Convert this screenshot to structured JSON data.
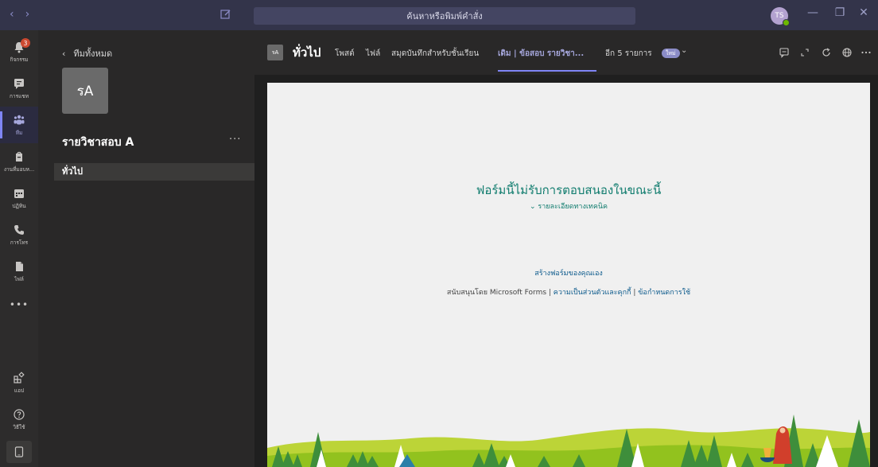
{
  "titlebar": {
    "search_placeholder": "ค้นหาหรือพิมพ์คำสั่ง",
    "avatar_initials": "TS",
    "back_arrow": "‹",
    "forward_arrow": "›",
    "minimize": "—",
    "maximize": "❐",
    "close": "✕"
  },
  "rail": {
    "items": [
      {
        "label": "กิจกรรม",
        "icon": "bell-icon",
        "badge": "3"
      },
      {
        "label": "การแชท",
        "icon": "chat-icon"
      },
      {
        "label": "ทีม",
        "icon": "teams-icon"
      },
      {
        "label": "งานที่มอบห...",
        "icon": "assignments-icon"
      },
      {
        "label": "ปฏิทิน",
        "icon": "calendar-icon"
      },
      {
        "label": "การโทร",
        "icon": "phone-icon"
      },
      {
        "label": "ไฟล์",
        "icon": "file-icon"
      },
      {
        "label": "แอป",
        "icon": "apps-icon"
      },
      {
        "label": "วิธีใช้",
        "icon": "help-icon"
      }
    ],
    "more": "•••",
    "active_accent": "#7f85f5"
  },
  "panel": {
    "back_label": "ทีมทั้งหมด",
    "back_icon": "‹",
    "team_initials": "รA",
    "team_name": "รายวิชาสอบ A",
    "team_more": "···",
    "channel": "ทั่วไป"
  },
  "header": {
    "tile": "รA",
    "title": "ทั่วไป",
    "tabs": [
      {
        "label": "โพสต์",
        "active": false
      },
      {
        "label": "ไฟล์",
        "active": false
      },
      {
        "label": "สมุดบันทึกสำหรับชั้นเรียน",
        "active": false
      },
      {
        "label": "เดิม | ข้อสอบ รายวิชา...",
        "active": true
      },
      {
        "label": "อีก 5 รายการ",
        "active": false
      }
    ],
    "new_badge": "ใหม่",
    "dropdown": "⌄"
  },
  "form": {
    "message": "ฟอร์มนี้ไม่รับการตอบสนองในขณะนี้",
    "tech_details": "รายละเอียดทางเทคนิค",
    "tech_chevron": "⌄",
    "create_link": "สร้างฟอร์มของคุณเอง",
    "powered_by": "สนับสนุนโดย Microsoft Forms |",
    "privacy": "ความเป็นส่วนตัวและคุกกี้",
    "separator": "|",
    "terms": "ข้อกำหนดการใช้",
    "accent_color": "#107c6e"
  }
}
